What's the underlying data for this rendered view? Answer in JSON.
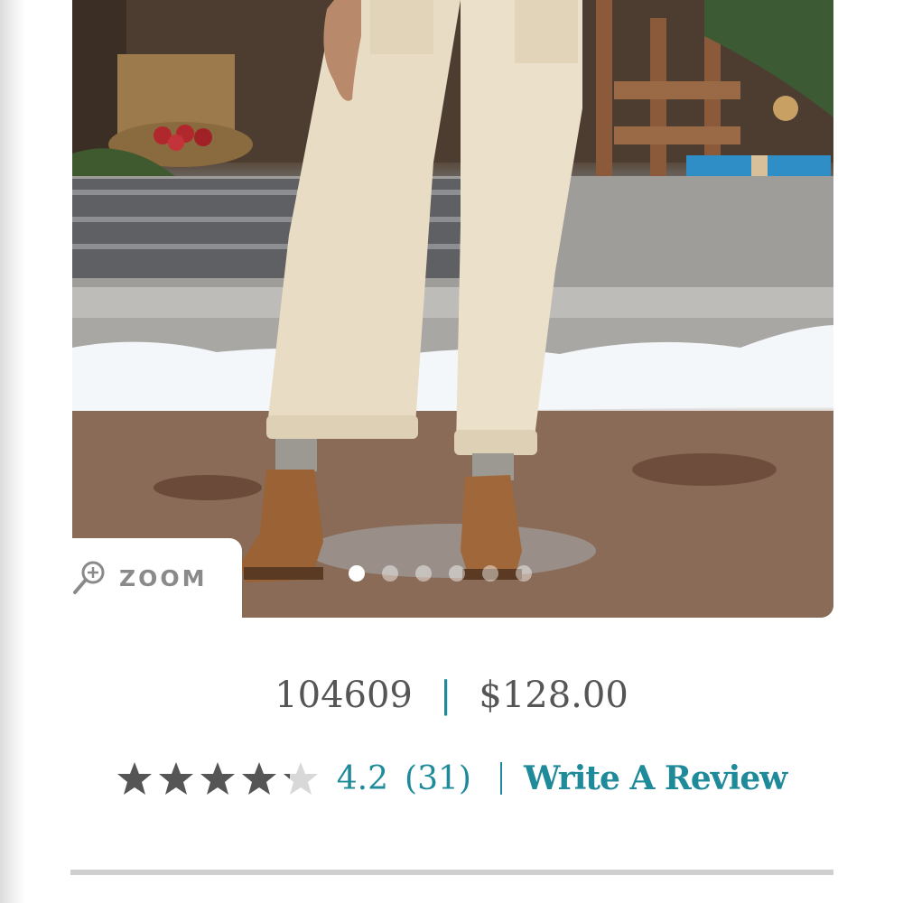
{
  "product": {
    "image_alt": "Cream corduroy pants with cuffed hems worn with tan suede ankle boots",
    "sku": "104609",
    "price": "$128.00"
  },
  "zoom": {
    "label": "ZOOM",
    "icon": "magnifier-plus-icon"
  },
  "carousel": {
    "count": 6,
    "active_index": 0
  },
  "rating": {
    "value_text": "4.2",
    "value": 4.2,
    "max": 5,
    "count_text": "(31)",
    "write_review_label": "Write A Review"
  },
  "colors": {
    "accent": "#1f8a9a",
    "text": "#555555",
    "star_filled": "#555555",
    "star_empty": "#d8d8d8",
    "divider": "#cfcfcf"
  }
}
